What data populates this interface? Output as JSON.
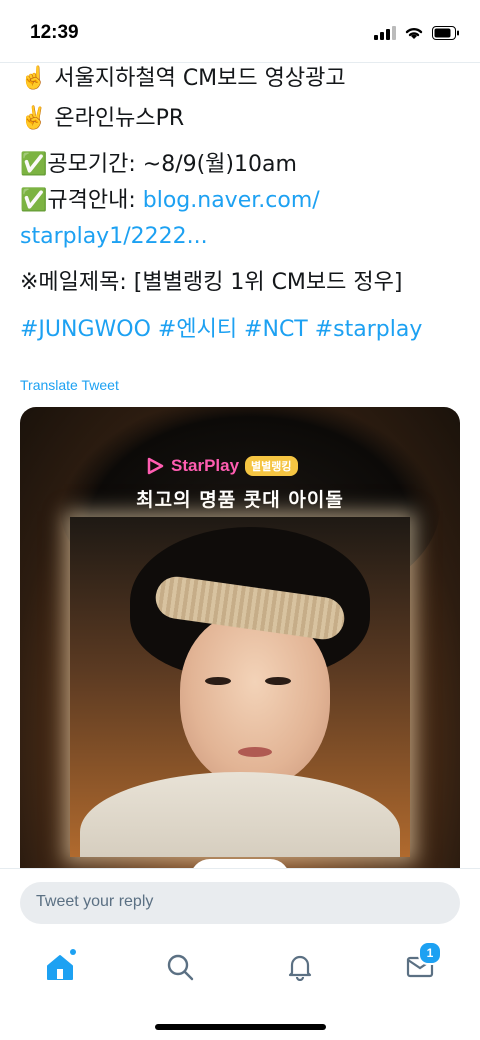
{
  "status_bar": {
    "time": "12:39"
  },
  "tweet": {
    "lines": [
      "☝️ 서울지하철역 CM보드 영상광고",
      "✌️ 온라인뉴스PR",
      "✅공모기간: ~8/9(월)10am",
      "✅규격안내: ",
      "※메일제목: [별별랭킹 1위 CM보드 정우]"
    ],
    "spec_link": "blog.naver.com/",
    "spec_link_cont": "starplay1/2222...",
    "hashtags": "#JUNGWOO #엔시티 #NCT #starplay",
    "translate": "Translate Tweet"
  },
  "media": {
    "brand": "StarPlay",
    "rank_badge": "별별랭킹",
    "headline": "최고의 명품 콧대 아이돌"
  },
  "reply": {
    "placeholder": "Tweet your reply"
  },
  "tabbar": {
    "messages_badge": "1"
  },
  "colors": {
    "accent": "#1da1f2",
    "brand_pink": "#ff5db1"
  }
}
